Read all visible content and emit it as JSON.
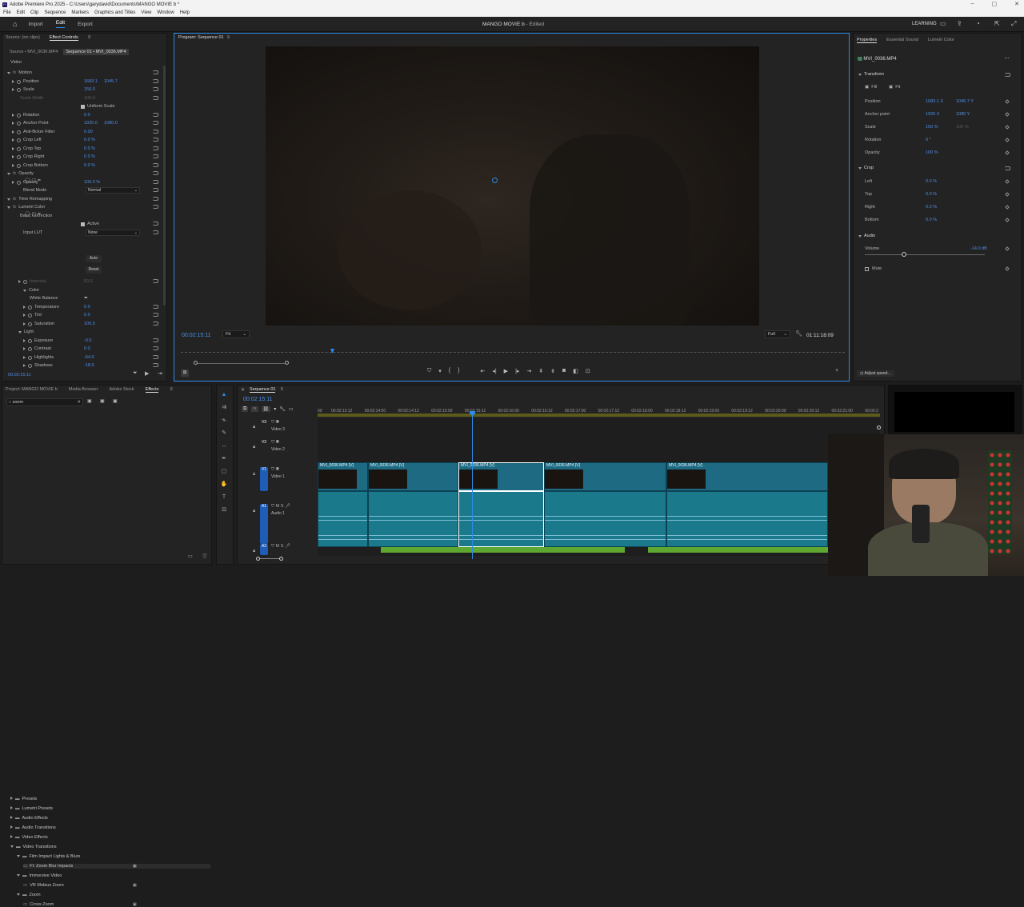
{
  "window": {
    "title": "Adobe Premiere Pro 2025 - C:\\Users\\garydavid\\Documents\\MANGO MOVIE b *"
  },
  "menu": [
    "File",
    "Edit",
    "Clip",
    "Sequence",
    "Markers",
    "Graphics and Titles",
    "View",
    "Window",
    "Help"
  ],
  "appbar": {
    "tabs": [
      "Import",
      "Edit",
      "Export"
    ],
    "active": "Edit",
    "project_title": "MANGO MOVIE b",
    "status": "- Edited",
    "learning": "LEARNING"
  },
  "effect_controls": {
    "tabs": [
      "Source: (no clips)",
      "Effect Controls"
    ],
    "source_tab": "Source • MVI_0036.MP4",
    "sequence_tab": "Sequence 01 • MVI_0036.MP4",
    "section_video": "Video",
    "rows": [
      {
        "label": "Motion",
        "type": "fx"
      },
      {
        "label": "Position",
        "v1": "1683.1",
        "v2": "1045.7"
      },
      {
        "label": "Scale",
        "v1": "150.0"
      },
      {
        "label": "Scale Width",
        "v1": "100.0",
        "dim": true
      },
      {
        "label": "Uniform Scale",
        "checkbox": true
      },
      {
        "label": "Rotation",
        "v1": "0.0"
      },
      {
        "label": "Anchor Point",
        "v1": "1920.0",
        "v2": "1080.0"
      },
      {
        "label": "Anti-flicker Filter",
        "v1": "0.00"
      },
      {
        "label": "Crop Left",
        "v1": "0.0 %"
      },
      {
        "label": "Crop Top",
        "v1": "0.0 %"
      },
      {
        "label": "Crop Right",
        "v1": "0.0 %"
      },
      {
        "label": "Crop Bottom",
        "v1": "0.0 %"
      },
      {
        "label": "Opacity",
        "type": "fx"
      },
      {
        "label": "Opacity",
        "v1": "100.0 %"
      },
      {
        "label": "Blend Mode",
        "select": "Normal"
      },
      {
        "label": "Time Remapping",
        "type": "fx"
      },
      {
        "label": "Lumetri Color",
        "type": "fx"
      },
      {
        "label": "Basic Correction"
      },
      {
        "label": "Active",
        "checkbox": true
      },
      {
        "label": "Input LUT",
        "select": "None"
      }
    ],
    "auto": "Auto",
    "reset": "Reset",
    "rows2": [
      {
        "label": "Intensity",
        "v1": "50.0",
        "dim": true
      },
      {
        "label": "Color"
      },
      {
        "label": "White Balance"
      },
      {
        "label": "Temperature",
        "v1": "0.0"
      },
      {
        "label": "Tint",
        "v1": "0.0"
      },
      {
        "label": "Saturation",
        "v1": "100.0"
      },
      {
        "label": "Light"
      },
      {
        "label": "Exposure",
        "v1": "-0.5"
      },
      {
        "label": "Contrast",
        "v1": "0.0"
      },
      {
        "label": "Highlights",
        "v1": "-64.0"
      },
      {
        "label": "Shadows",
        "v1": "-18.0"
      }
    ],
    "timecode": "00:02:15:11"
  },
  "program": {
    "title": "Program: Sequence 01",
    "timecode": "00:02:15:11",
    "fit": "Fit",
    "quality": "Full",
    "duration": "01:11:18:09"
  },
  "properties": {
    "tabs": [
      "Properties",
      "Essential Sound",
      "Lumetri Color"
    ],
    "clip": "MVI_0036.MP4",
    "transform": "Transform",
    "fill": "Fill",
    "fitbtn": "Fit",
    "rows": [
      {
        "label": "Position",
        "v1": "1683.1 X",
        "v2": "1045.7 Y"
      },
      {
        "label": "Anchor point",
        "v1": "1920 X",
        "v2": "1080 Y"
      },
      {
        "label": "Scale",
        "v1": "150 %",
        "v2": "100 %"
      },
      {
        "label": "Rotation",
        "v1": "0 °"
      },
      {
        "label": "Opacity",
        "v1": "100 %"
      }
    ],
    "crop": "Crop",
    "crop_rows": [
      {
        "label": "Left",
        "v1": "0.0 %"
      },
      {
        "label": "Top",
        "v1": "0.0 %"
      },
      {
        "label": "Right",
        "v1": "0.0 %"
      },
      {
        "label": "Bottom",
        "v1": "0.0 %"
      }
    ],
    "audio": "Audio",
    "volume": "Volume",
    "volume_val": "-14.0 dB",
    "mute": "Mute",
    "adjust_speed": "Adjust speed..."
  },
  "project": {
    "tabs": [
      "Project: MANGO MOVIE b",
      "Media Browser",
      "Adobe Stock",
      "Effects"
    ],
    "search": "zoom",
    "tree": [
      {
        "label": "Presets",
        "level": 0
      },
      {
        "label": "Lumetri Presets",
        "level": 0
      },
      {
        "label": "Audio Effects",
        "level": 0
      },
      {
        "label": "Audio Transitions",
        "level": 0
      },
      {
        "label": "Video Effects",
        "level": 0
      },
      {
        "label": "Video Transitions",
        "level": 0
      },
      {
        "label": "Film Impact Lights & Blurs",
        "level": 1
      },
      {
        "label": "FI: Zoom Blur Impacts",
        "level": 2
      },
      {
        "label": "Immersive Video",
        "level": 1
      },
      {
        "label": "VR Mobius Zoom",
        "level": 2
      },
      {
        "label": "Zoom",
        "level": 1
      },
      {
        "label": "Cross Zoom",
        "level": 2
      }
    ]
  },
  "timeline": {
    "tab": "Sequence 01",
    "timecode": "00:02:15:11",
    "ruler": [
      "00",
      "00:02:13:12",
      "00:02:14:00",
      "00:02:14:12",
      "00:02:15:00",
      "00:02:15:12",
      "00:02:16:00",
      "00:02:16:12",
      "00:02:17:00",
      "00:02:17:12",
      "00:02:18:00",
      "00:02:18:12",
      "00:02:19:00",
      "00:02:19:12",
      "00:02:20:00",
      "00:02:20:12",
      "00:02:21:00",
      "00:02:2"
    ],
    "tracks": [
      {
        "id": "V3",
        "name": "Video 3"
      },
      {
        "id": "V2",
        "name": "Video 2"
      },
      {
        "id": "V1",
        "name": "Video 1"
      },
      {
        "id": "A1",
        "name": "Audio 1"
      },
      {
        "id": "A2",
        "name": ""
      }
    ],
    "clips": [
      "MVI_0036.MP4 [V]",
      "MVI_0036.MP4 [V]",
      "MVI_0036.MP4 [V]",
      "MVI_0036.MP4 [V]",
      "MVI_0036.MP4 [V]"
    ]
  },
  "colors": {
    "accent": "#2d8ceb",
    "clip": "#1d6a82",
    "audio": "#1a7a8c",
    "audio_green": "#5ea832"
  }
}
